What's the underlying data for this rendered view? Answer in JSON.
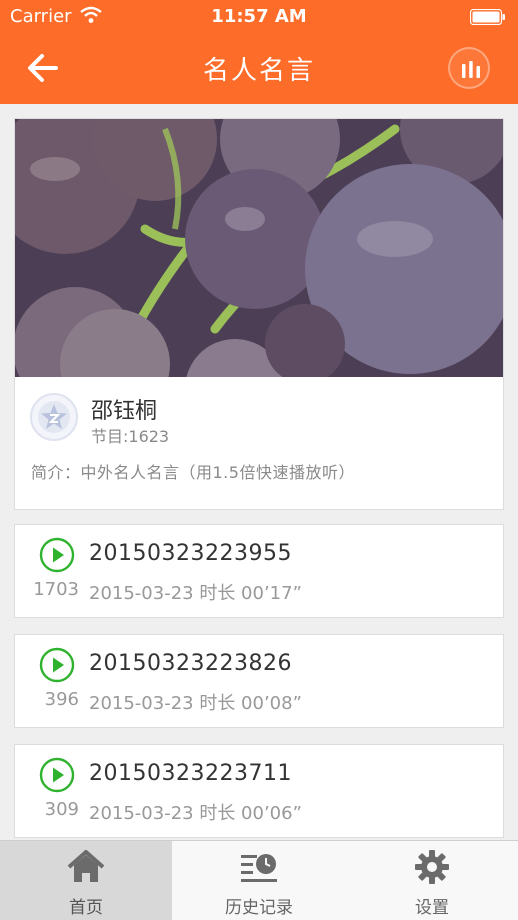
{
  "status_bar": {
    "carrier": "Carrier",
    "time": "11:57 AM"
  },
  "nav": {
    "title": "名人名言"
  },
  "album": {
    "author": "邵钰桐",
    "episodes": "节目:1623",
    "intro": "简介：中外名人名言（用1.5倍快速播放听）"
  },
  "tracks": [
    {
      "title": "20150323223955",
      "plays": "1703",
      "meta": "2015-03-23  时长 00’17”"
    },
    {
      "title": "20150323223826",
      "plays": "396",
      "meta": "2015-03-23  时长 00’08”"
    },
    {
      "title": "20150323223711",
      "plays": "309",
      "meta": "2015-03-23  时长 00’06”"
    }
  ],
  "tabbar": {
    "tabs": [
      {
        "label": "首页",
        "icon": "home-icon",
        "active": true
      },
      {
        "label": "历史记录",
        "icon": "history-icon",
        "active": false
      },
      {
        "label": "设置",
        "icon": "gear-icon",
        "active": false
      }
    ]
  },
  "colors": {
    "accent": "#fd6c29",
    "play_green": "#2fb32f"
  }
}
